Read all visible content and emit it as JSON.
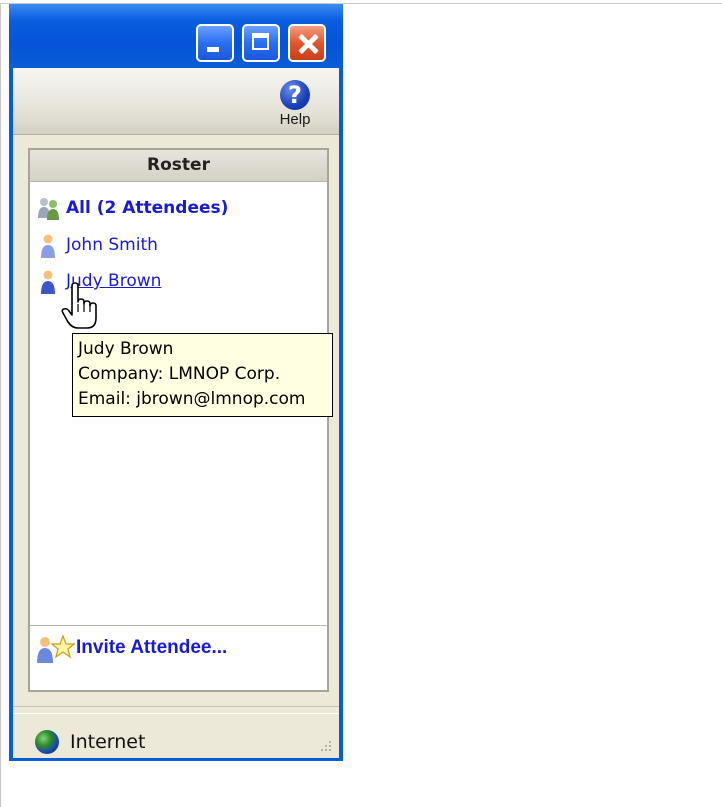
{
  "window": {
    "controls": {
      "minimize": "minimize",
      "maximize": "maximize",
      "close": "close"
    }
  },
  "toolbar": {
    "help_label": "Help",
    "help_icon": "help-icon"
  },
  "roster": {
    "title": "Roster",
    "items": [
      {
        "label": "All (2 Attendees)",
        "icon": "group-icon"
      },
      {
        "label": "John Smith",
        "icon": "person-icon"
      },
      {
        "label": "Judy Brown",
        "icon": "person-icon",
        "hovered": true
      }
    ],
    "invite_label": "Invite Attendee...",
    "invite_icon": "invite-star-icon"
  },
  "tooltip": {
    "name": "Judy Brown",
    "company": "Company: LMNOP Corp.",
    "email": "Email: jbrown@lmnop.com"
  },
  "statusbar": {
    "zone": "Internet",
    "zone_icon": "globe-icon"
  },
  "colors": {
    "titlebar": "#0a5cd6",
    "link": "#1a1ad0",
    "tooltip_bg": "#ffffe1",
    "chrome": "#ece9d8"
  }
}
